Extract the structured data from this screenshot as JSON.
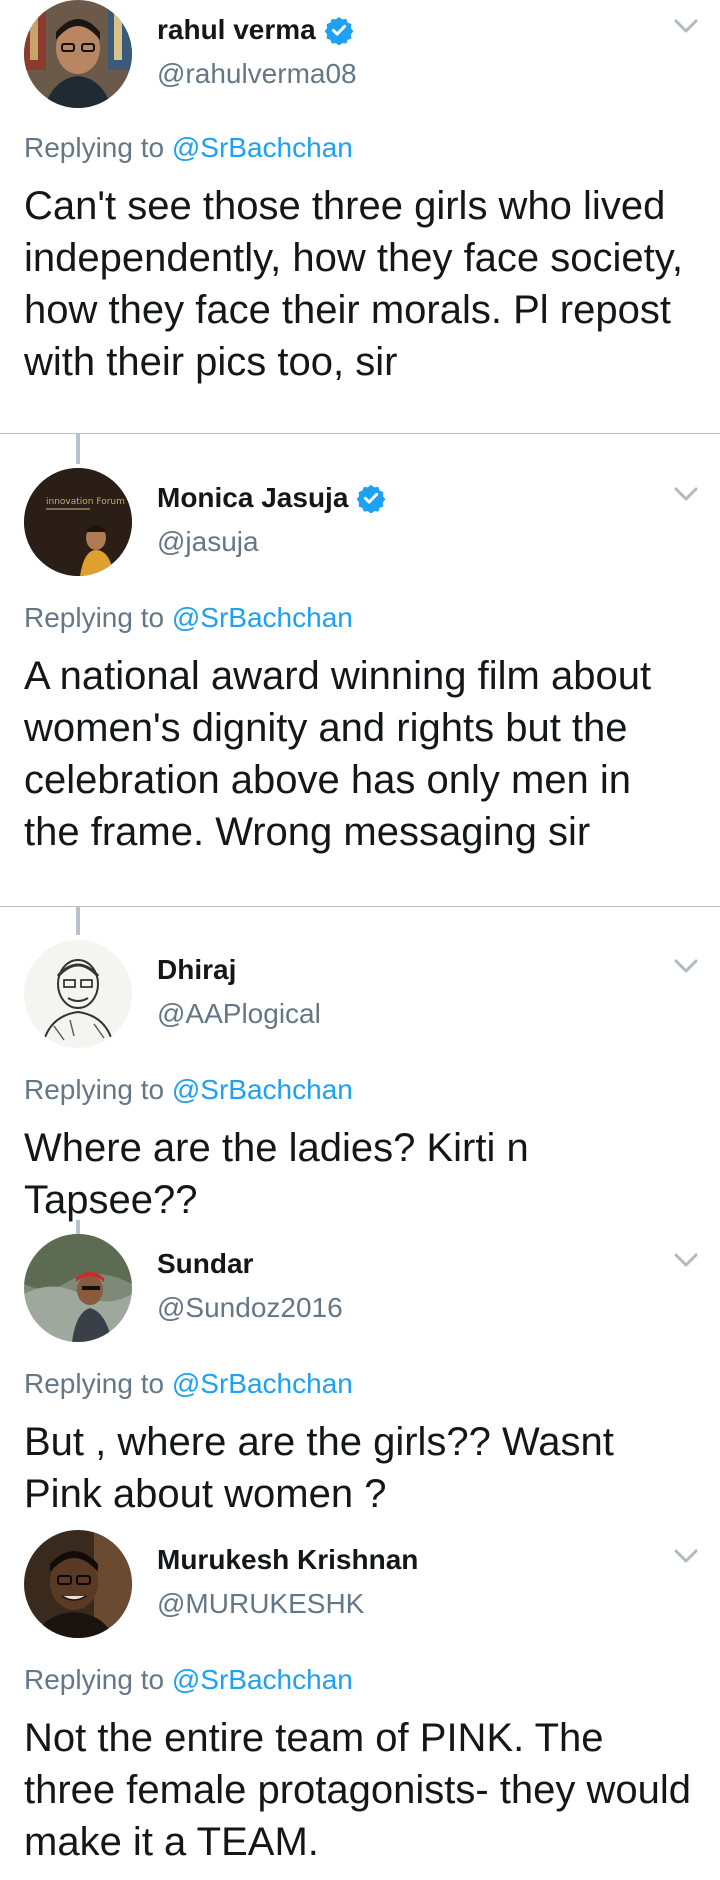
{
  "replying_prefix": "Replying to",
  "colors": {
    "verified_blue": "#1da1f2",
    "link_blue": "#1da1f2",
    "secondary_text": "#657786",
    "primary_text": "#14171a"
  },
  "tweets": [
    {
      "name": "rahul verma",
      "verified": true,
      "handle": "@rahulverma08",
      "replying_to": "@SrBachchan",
      "text": "Can't see those three girls who lived independently, how they face society, how they face their morals. Pl repost with their pics too, sir",
      "menu_icon": "chevron-down-icon"
    },
    {
      "name": "Monica Jasuja",
      "verified": true,
      "handle": "@jasuja",
      "replying_to": "@SrBachchan",
      "text": "A national award winning film about women's dignity and rights but the celebration above has only men in the frame. Wrong messaging sir",
      "menu_icon": "chevron-down-icon",
      "avatar_caption": "innovation Forum"
    },
    {
      "name": "Dhiraj",
      "verified": false,
      "handle": "@AAPlogical",
      "replying_to": "@SrBachchan",
      "text": "Where are the ladies? Kirti n Tapsee??",
      "menu_icon": "chevron-down-icon"
    },
    {
      "name": "Sundar",
      "verified": false,
      "handle": "@Sundoz2016",
      "replying_to": "@SrBachchan",
      "text": "But , where are the girls?? Wasnt Pink about women ?",
      "menu_icon": "chevron-down-icon"
    },
    {
      "name": "Murukesh Krishnan",
      "verified": false,
      "handle": "@MURUKESHK",
      "replying_to": "@SrBachchan",
      "text": "Not the entire team of PINK. The three female protagonists- they would make it a TEAM.",
      "menu_icon": "chevron-down-icon"
    }
  ]
}
